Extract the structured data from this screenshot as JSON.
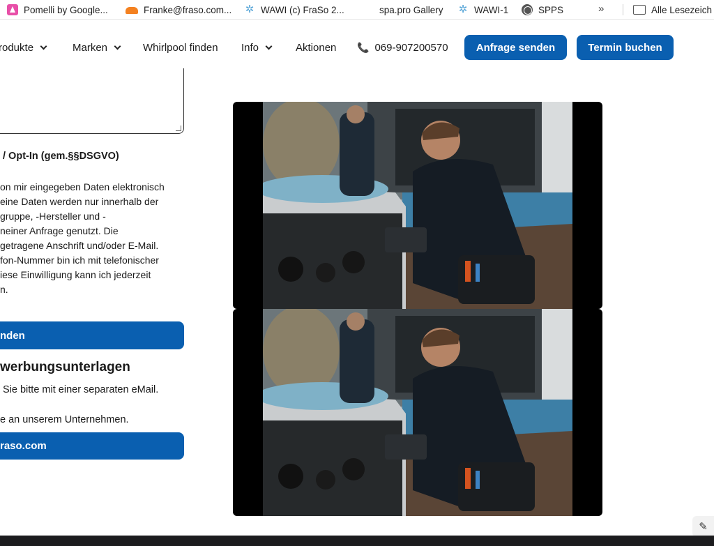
{
  "bookmarks": {
    "items": [
      {
        "label": "Pomelli by Google...",
        "icon": "pomelli-icon"
      },
      {
        "label": "Franke@fraso.com...",
        "icon": "cloud-icon"
      },
      {
        "label": "WAWI (c) FraSo 2...",
        "icon": "star-icon"
      },
      {
        "label": "spa.pro Gallery",
        "icon": ""
      },
      {
        "label": "WAWI-1",
        "icon": "star-icon"
      },
      {
        "label": "SPPS",
        "icon": "globe-icon"
      }
    ],
    "more": "»",
    "folder_label": "Alle Lesezeich"
  },
  "nav": {
    "produkte": "rodukte",
    "marken": "Marken",
    "whirlpool": "Whirlpool finden",
    "info": "Info",
    "aktionen": "Aktionen",
    "phone": "069-907200570",
    "anfrage_button": "Anfrage senden",
    "termin_button": "Termin buchen"
  },
  "form": {
    "consent_title": "/ Opt-In (gem.§§DSGVO)",
    "consent_lines": [
      "on mir eingegeben Daten elektronisch",
      "eine Daten werden nur innerhalb der",
      "gruppe, -Hersteller und -",
      "neiner Anfrage genutzt. Die",
      "getragene Anschrift und/oder E-Mail.",
      "fon-Nummer bin ich mit telefonischer",
      "iese Einwilligung kann ich jederzeit",
      "n."
    ],
    "send_button": "nden"
  },
  "bewerbung": {
    "heading": "werbungsunterlagen",
    "line1": "Sie bitte mit einer separaten eMail.",
    "line2": "e an unserem Unternehmen.",
    "email_button": "raso.com"
  },
  "colors": {
    "brand_blue": "#0a5fb0"
  }
}
